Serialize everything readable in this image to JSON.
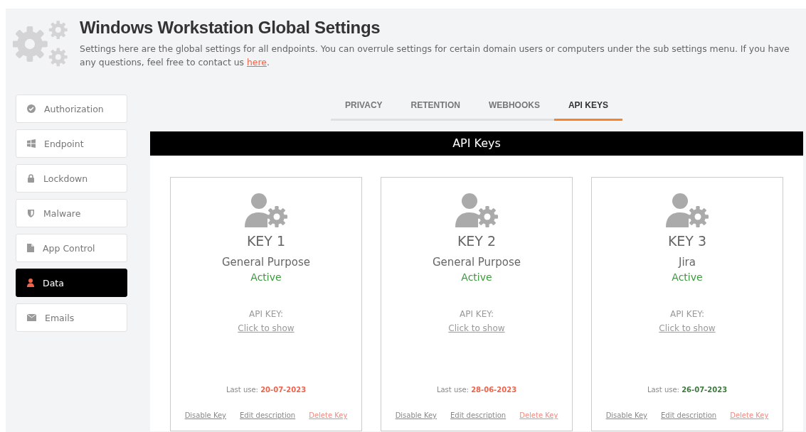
{
  "header": {
    "title": "Windows Workstation Global Settings",
    "description": "Settings here are the global settings for all endpoints. You can overrule settings for certain domain users or computers under the sub settings menu. If you have any questions, feel free to contact us ",
    "link": "here",
    "after_link": "."
  },
  "sidebar": {
    "items": [
      {
        "label": "Authorization",
        "selected": false
      },
      {
        "label": "Endpoint",
        "selected": false
      },
      {
        "label": "Lockdown",
        "selected": false
      },
      {
        "label": "Malware",
        "selected": false
      },
      {
        "label": "App Control",
        "selected": false
      },
      {
        "label": "Data",
        "selected": true
      },
      {
        "label": "Emails",
        "selected": false
      }
    ]
  },
  "tabs": [
    {
      "label": "PRIVACY",
      "selected": false
    },
    {
      "label": "RETENTION",
      "selected": false
    },
    {
      "label": "WEBHOOKS",
      "selected": false
    },
    {
      "label": "API KEYS",
      "selected": true
    }
  ],
  "panel": {
    "title": "API Keys"
  },
  "keys": [
    {
      "name": "KEY 1",
      "description": "General Purpose",
      "status": "Active",
      "api_key_label": "API KEY:",
      "show_link": "Click to show",
      "last_use_label": "Last use:",
      "last_use": "20-07-2023",
      "color": "#f0634a",
      "actions": [
        "Disable Key",
        "Edit description",
        "Delete Key"
      ]
    },
    {
      "name": "KEY 2",
      "description": "General Purpose",
      "status": "Active",
      "api_key_label": "API KEY:",
      "show_link": "Click to show",
      "last_use_label": "Last use:",
      "last_use": "28-06-2023",
      "color": "#f0634a",
      "actions": [
        "Disable Key",
        "Edit description",
        "Delete Key"
      ]
    },
    {
      "name": "KEY 3",
      "description": "Jira",
      "status": "Active",
      "api_key_label": "API KEY:",
      "show_link": "Click to show",
      "last_use_label": "Last use:",
      "last_use": "26-07-2023",
      "color": "#3d7a3d",
      "actions": [
        "Disable Key",
        "Edit description",
        "Delete Key"
      ]
    }
  ]
}
